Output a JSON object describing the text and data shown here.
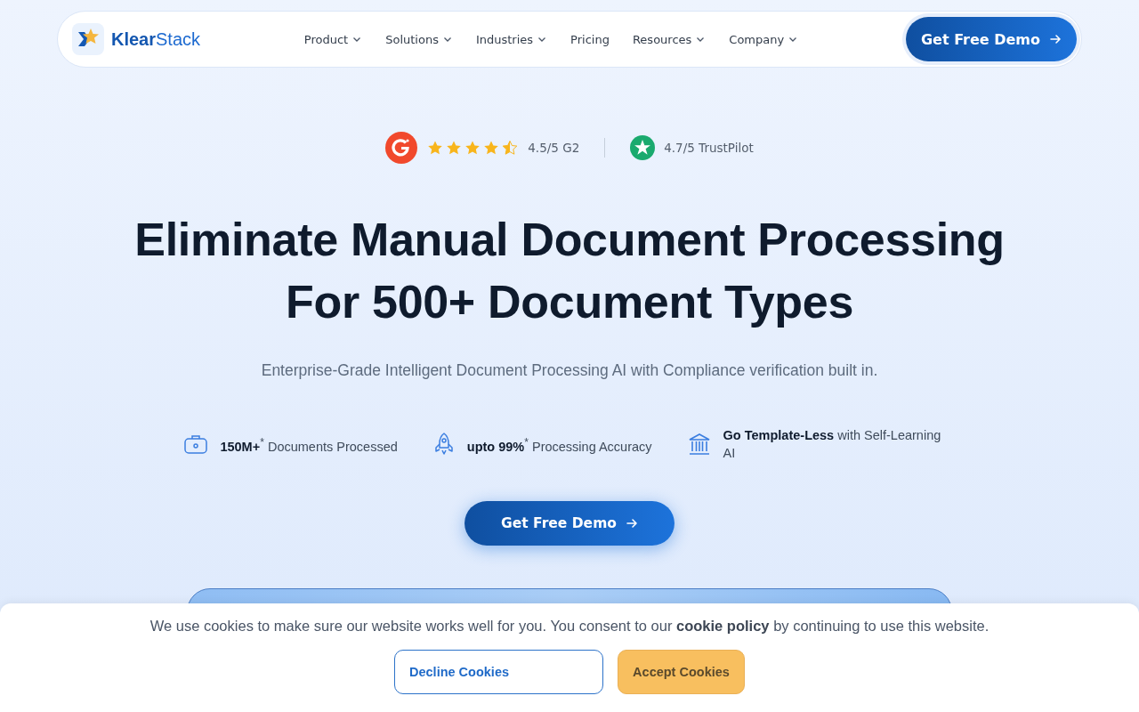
{
  "nav": {
    "logo": "**Klear**Stack",
    "items": [
      {
        "label": "Product",
        "dropdown": true
      },
      {
        "label": "Solutions",
        "dropdown": true
      },
      {
        "label": "Industries",
        "dropdown": true
      },
      {
        "label": "Pricing",
        "dropdown": false
      },
      {
        "label": "Resources",
        "dropdown": true
      },
      {
        "label": "Company",
        "dropdown": true
      }
    ],
    "cta": "Get Free Demo"
  },
  "ratings": [
    {
      "kind": "g2",
      "stars": 4.5,
      "text": "4.5/5 G2"
    },
    {
      "kind": "trustpilot",
      "text": "4.7/5 TrustPilot"
    }
  ],
  "headline": [
    "Eliminate Manual Document Processing",
    "For 500+ Document Types"
  ],
  "subtitle": "Enterprise-Grade Intelligent Document Processing AI with Compliance verification built in.",
  "stats": [
    {
      "kind": "toolbox",
      "text": "**150M+**$^{*}$ Documents Processed"
    },
    {
      "kind": "rocket",
      "text": "**upto 99%**$^{*}$ Processing Accuracy"
    },
    {
      "kind": "bank",
      "text": "**Go Template-Less** with Self-Learning AI"
    }
  ],
  "cta": "Get Free Demo",
  "cookie_banner": {
    "text_before": "We use cookies to make sure our website works well for you. You consent to our",
    "link": "cookie policy",
    "text_after": "by continuing to use this website.",
    "decline": "Decline Cookies",
    "accept": "Accept Cookies"
  }
}
